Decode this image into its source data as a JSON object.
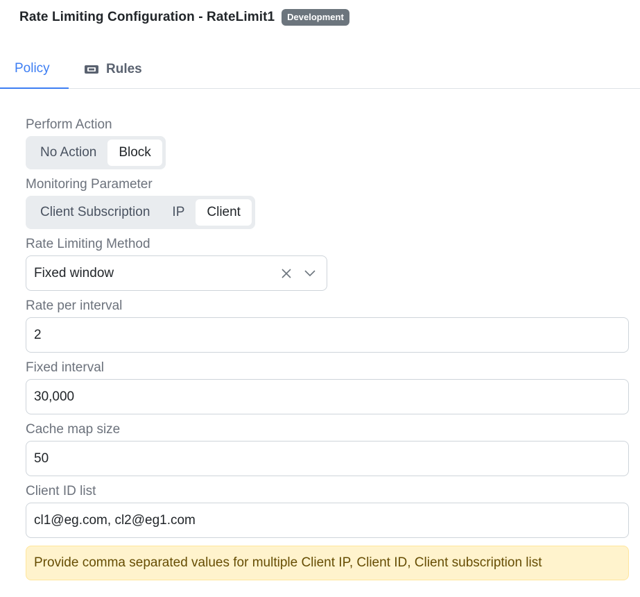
{
  "header": {
    "title": "Rate Limiting Configuration - RateLimit1",
    "badge": "Development"
  },
  "tabs": [
    {
      "label": "Policy",
      "active": true
    },
    {
      "label": "Rules",
      "icon": "ticket-icon",
      "active": false
    }
  ],
  "form": {
    "perform_action": {
      "label": "Perform Action",
      "options": [
        "No Action",
        "Block"
      ],
      "selected": "Block"
    },
    "monitoring_parameter": {
      "label": "Monitoring Parameter",
      "options": [
        "Client Subscription",
        "IP",
        "Client"
      ],
      "selected": "Client"
    },
    "rate_limiting_method": {
      "label": "Rate Limiting Method",
      "value": "Fixed window"
    },
    "rate_per_interval": {
      "label": "Rate per interval",
      "value": "2"
    },
    "fixed_interval": {
      "label": "Fixed interval",
      "value": "30,000"
    },
    "cache_map_size": {
      "label": "Cache map size",
      "value": "50"
    },
    "client_id_list": {
      "label": "Client ID list",
      "value": "cl1@eg.com, cl2@eg1.com"
    },
    "hint": "Provide comma separated values for multiple Client IP, Client ID, Client subscription list"
  },
  "colors": {
    "accent": "#3d7ef3",
    "badge_bg": "#6c757d",
    "alert_bg": "#fff3cd",
    "alert_text": "#664d03"
  }
}
